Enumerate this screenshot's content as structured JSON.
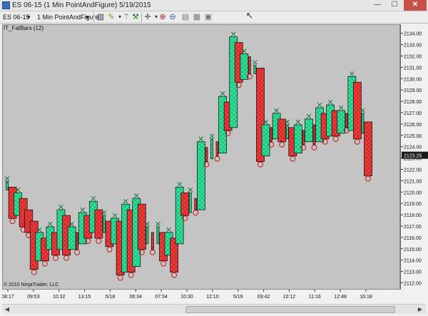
{
  "window": {
    "title": "ES 06-15 (1 Min PointAndFigure)  5/19/2015",
    "min": "—",
    "max": "☐",
    "close": "✕"
  },
  "toolbar": {
    "instrument": "ES 06-15",
    "interval": "1 Min PointAndFigure"
  },
  "chart": {
    "indicator": "IT_FatBars (12)",
    "copyright": "© 2015 NinjaTrader, LLC"
  },
  "colors": {
    "up": "#2ee39b",
    "down": "#ef3b3b",
    "background": "#c4c4c4",
    "markerX": "#0a7a3a",
    "markerO": "#c01818"
  },
  "chart_data": {
    "type": "candlestick",
    "price_min": 2111.4,
    "price_max": 2134.8,
    "y_ticks": [
      2112,
      2113,
      2114,
      2115,
      2116,
      2117,
      2118,
      2119,
      2120,
      2121,
      2122,
      2123,
      2124,
      2125,
      2126,
      2127,
      2128,
      2129,
      2130,
      2131,
      2132,
      2133,
      2134
    ],
    "y_tick_labels": [
      "2112.00",
      "2113.00",
      "2114.00",
      "2115.00",
      "2116.00",
      "2117.00",
      "2118.00",
      "2119.00",
      "2120.00",
      "2121.00",
      "2122.00",
      "2123.00",
      "2124.00",
      "2125.00",
      "2126.00",
      "2127.00",
      "2128.00",
      "2129.00",
      "2130.00",
      "2131.00",
      "2132.00",
      "2133.00",
      "2134.00"
    ],
    "current_price": "2123.25",
    "x_labels": [
      "08:17",
      "09:53",
      "10:32",
      "13:15",
      "5/18",
      "06:34",
      "07:54",
      "10:30",
      "12:10",
      "5/19",
      "09:42",
      "10:12",
      "11:16",
      "12:48",
      "16:18"
    ],
    "bars": [
      {
        "dir": "up",
        "open": 2120.25,
        "close": 2121.0
      },
      {
        "dir": "down",
        "open": 2120.5,
        "close": 2117.75
      },
      {
        "dir": "up",
        "open": 2118.0,
        "close": 2120.0
      },
      {
        "dir": "down",
        "open": 2119.5,
        "close": 2117.0
      },
      {
        "dir": "down",
        "open": 2118.5,
        "close": 2116.5
      },
      {
        "dir": "down",
        "open": 2117.5,
        "close": 2113.25
      },
      {
        "dir": "up",
        "open": 2114.0,
        "close": 2116.5
      },
      {
        "dir": "down",
        "open": 2116.0,
        "close": 2114.0
      },
      {
        "dir": "up",
        "open": 2115.0,
        "close": 2117.0
      },
      {
        "dir": "down",
        "open": 2116.5,
        "close": 2114.5
      },
      {
        "dir": "up",
        "open": 2115.0,
        "close": 2118.5
      },
      {
        "dir": "down",
        "open": 2118.0,
        "close": 2114.5
      },
      {
        "dir": "up",
        "open": 2115.0,
        "close": 2117.0
      },
      {
        "dir": "down",
        "open": 2116.5,
        "close": 2115.0
      },
      {
        "dir": "up",
        "open": 2115.5,
        "close": 2118.25
      },
      {
        "dir": "down",
        "open": 2118.0,
        "close": 2116.0
      },
      {
        "dir": "up",
        "open": 2116.5,
        "close": 2119.25
      },
      {
        "dir": "down",
        "open": 2118.5,
        "close": 2116.0
      },
      {
        "dir": "up",
        "open": 2116.5,
        "close": 2118.0
      },
      {
        "dir": "down",
        "open": 2117.5,
        "close": 2115.25
      },
      {
        "dir": "up",
        "open": 2115.5,
        "close": 2117.75
      },
      {
        "dir": "down",
        "open": 2117.5,
        "close": 2112.75
      },
      {
        "dir": "up",
        "open": 2113.0,
        "close": 2119.0
      },
      {
        "dir": "down",
        "open": 2118.5,
        "close": 2113.0
      },
      {
        "dir": "up",
        "open": 2113.5,
        "close": 2119.5
      },
      {
        "dir": "down",
        "open": 2119.0,
        "close": 2115.0
      },
      {
        "dir": "up",
        "open": 2115.5,
        "close": 2117.0
      },
      {
        "dir": "down",
        "open": 2116.5,
        "close": 2115.0
      },
      {
        "dir": "up",
        "open": 2115.5,
        "close": 2117.0
      },
      {
        "dir": "down",
        "open": 2116.5,
        "close": 2114.0
      },
      {
        "dir": "up",
        "open": 2114.5,
        "close": 2116.5
      },
      {
        "dir": "down",
        "open": 2116.0,
        "close": 2113.0
      },
      {
        "dir": "up",
        "open": 2115.5,
        "close": 2120.5
      },
      {
        "dir": "down",
        "open": 2120.0,
        "close": 2118.0
      },
      {
        "dir": "up",
        "open": 2118.25,
        "close": 2120.0
      },
      {
        "dir": "down",
        "open": 2119.5,
        "close": 2118.5
      },
      {
        "dir": "up",
        "open": 2118.5,
        "close": 2124.5
      },
      {
        "dir": "down",
        "open": 2124.0,
        "close": 2122.75
      },
      {
        "dir": "up",
        "open": 2123.0,
        "close": 2124.75
      },
      {
        "dir": "down",
        "open": 2124.5,
        "close": 2123.25
      },
      {
        "dir": "up",
        "open": 2123.5,
        "close": 2128.5
      },
      {
        "dir": "down",
        "open": 2128.0,
        "close": 2125.5
      },
      {
        "dir": "up",
        "open": 2125.75,
        "close": 2133.75
      },
      {
        "dir": "down",
        "open": 2133.25,
        "close": 2129.75
      },
      {
        "dir": "up",
        "open": 2130.0,
        "close": 2132.25
      },
      {
        "dir": "down",
        "open": 2132.0,
        "close": 2130.5
      },
      {
        "dir": "up",
        "open": 2130.5,
        "close": 2131.25
      },
      {
        "dir": "down",
        "open": 2131.0,
        "close": 2122.75
      },
      {
        "dir": "up",
        "open": 2123.25,
        "close": 2126.0
      },
      {
        "dir": "down",
        "open": 2125.75,
        "close": 2124.5
      },
      {
        "dir": "up",
        "open": 2124.75,
        "close": 2127.0
      },
      {
        "dir": "down",
        "open": 2126.5,
        "close": 2124.5
      },
      {
        "dir": "up",
        "open": 2124.75,
        "close": 2126.0
      },
      {
        "dir": "down",
        "open": 2125.75,
        "close": 2123.25
      },
      {
        "dir": "up",
        "open": 2123.5,
        "close": 2126.0
      },
      {
        "dir": "down",
        "open": 2125.5,
        "close": 2124.25
      },
      {
        "dir": "up",
        "open": 2124.5,
        "close": 2126.5
      },
      {
        "dir": "down",
        "open": 2126.0,
        "close": 2124.25
      },
      {
        "dir": "up",
        "open": 2124.5,
        "close": 2127.5
      },
      {
        "dir": "down",
        "open": 2127.0,
        "close": 2124.75
      },
      {
        "dir": "up",
        "open": 2125.0,
        "close": 2127.75
      },
      {
        "dir": "down",
        "open": 2127.25,
        "close": 2125.0
      },
      {
        "dir": "up",
        "open": 2125.25,
        "close": 2127.25
      },
      {
        "dir": "down",
        "open": 2127.0,
        "close": 2125.75
      },
      {
        "dir": "up",
        "open": 2125.5,
        "close": 2130.25
      },
      {
        "dir": "down",
        "open": 2129.75,
        "close": 2124.75
      },
      {
        "dir": "up",
        "open": 2125.25,
        "close": 2127.0
      },
      {
        "dir": "down",
        "open": 2126.25,
        "close": 2121.5
      }
    ]
  }
}
